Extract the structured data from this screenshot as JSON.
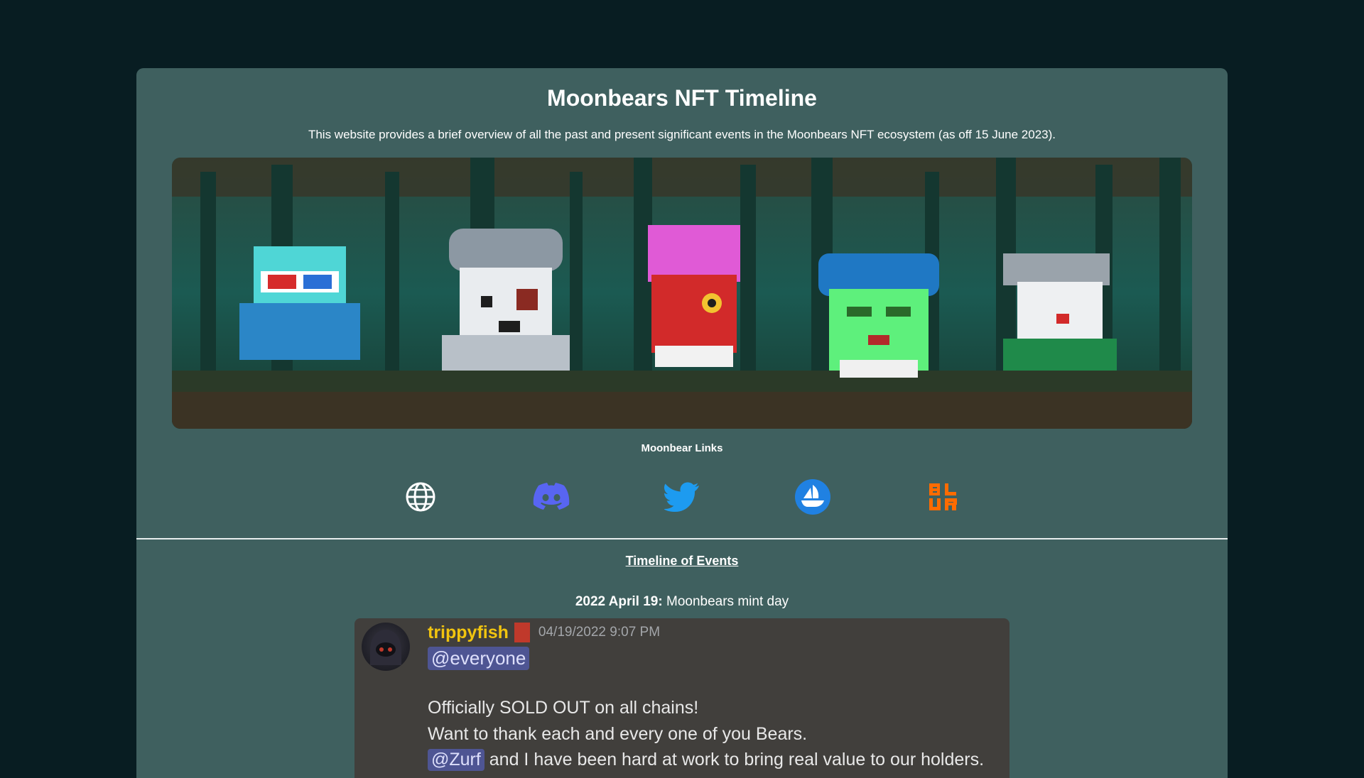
{
  "header": {
    "title": "Moonbears NFT Timeline",
    "subtitle": "This website provides a brief overview of all the past and present significant events in the Moonbears NFT ecosystem (as off 15 June 2023)."
  },
  "banner": {
    "alt": "Pixel-art Moonbears in a forest"
  },
  "links": {
    "label": "Moonbear Links",
    "items": [
      {
        "icon": "globe-icon",
        "color": "#ffffff"
      },
      {
        "icon": "discord-icon",
        "color": "#5865f2"
      },
      {
        "icon": "twitter-icon",
        "color": "#1d9bf0"
      },
      {
        "icon": "opensea-icon",
        "color": "#2081e2"
      },
      {
        "icon": "blur-icon",
        "color": "#ff6b00"
      }
    ]
  },
  "timeline": {
    "heading": "Timeline of Events",
    "events": [
      {
        "date": "2022 April 19:",
        "description": " Moonbears mint day",
        "message": {
          "username": "trippyfish",
          "timestamp": "04/19/2022 9:07 PM",
          "mention": "@everyone",
          "line1": "Officially SOLD OUT on all chains!",
          "line2": "Want to thank each and every one of you Bears.",
          "line3_mention": "@Zurf",
          "line3_text": " and I have been hard at work to bring real value to our holders."
        }
      }
    ]
  },
  "colors": {
    "page_bg": "#081d22",
    "panel_bg": "#3f605f",
    "username": "#f1c40f",
    "mention_bg": "#4e5593"
  }
}
